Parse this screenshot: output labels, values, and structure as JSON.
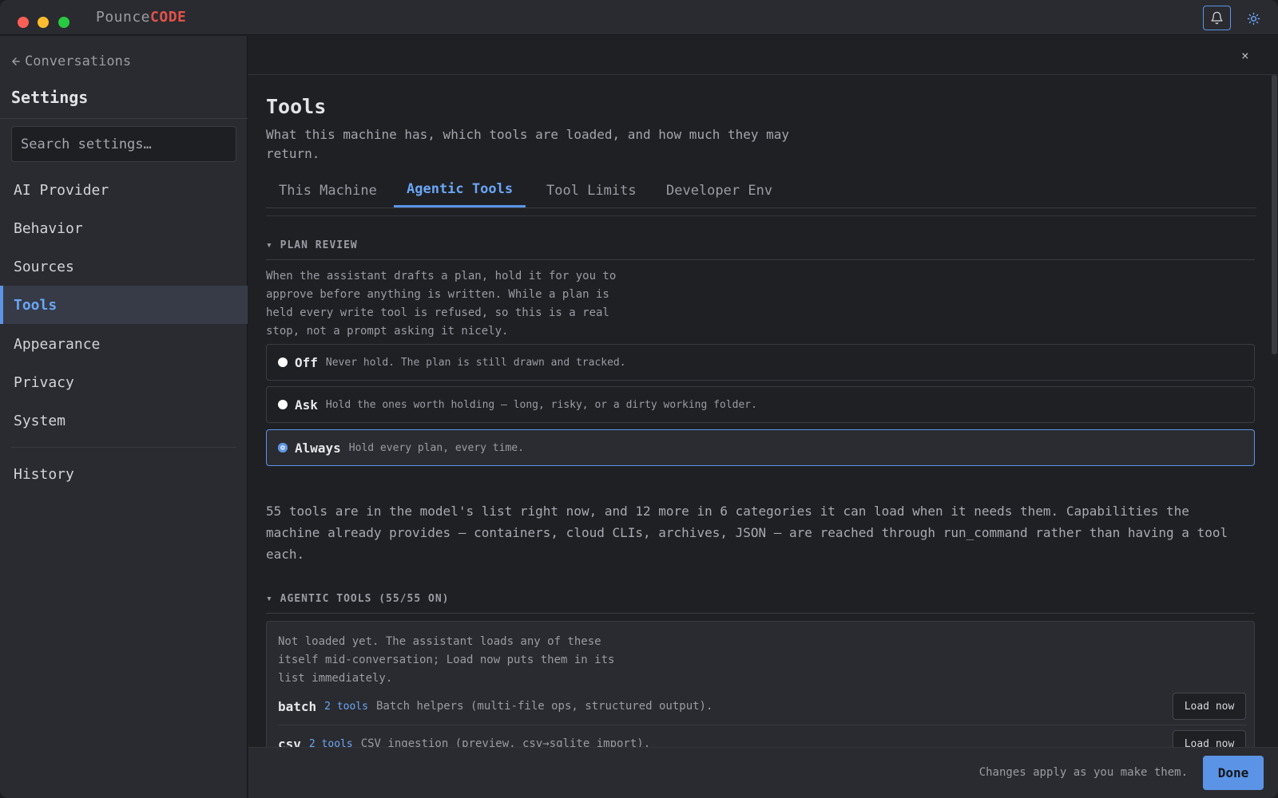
{
  "app": {
    "brand_a": "Pounce",
    "brand_b": "CODE"
  },
  "titlebar": {
    "bell_icon": "bell-icon",
    "theme_icon": "sun-icon"
  },
  "sidebar": {
    "back_label": "Conversations",
    "title": "Settings",
    "search_placeholder": "Search settings…",
    "items": [
      {
        "label": "AI Provider"
      },
      {
        "label": "Behavior"
      },
      {
        "label": "Sources"
      },
      {
        "label": "Tools",
        "active": true
      },
      {
        "label": "Appearance"
      },
      {
        "label": "Privacy"
      },
      {
        "label": "System"
      }
    ],
    "history_label": "History"
  },
  "main": {
    "close_label": "×",
    "title": "Tools",
    "subtitle": "What this machine has, which tools are loaded, and how much they may return.",
    "tabs": [
      {
        "label": "This Machine"
      },
      {
        "label": "Agentic Tools",
        "active": true
      },
      {
        "label": "Tool Limits"
      },
      {
        "label": "Developer Env"
      }
    ],
    "plan_review": {
      "heading": "▾ PLAN REVIEW",
      "description": "When the assistant drafts a plan, hold it for you to approve before anything is written. While a plan is held every write tool is refused, so this is a real stop, not a prompt asking it nicely.",
      "options": [
        {
          "name": "Off",
          "desc": "Never hold. The plan is still drawn and tracked."
        },
        {
          "name": "Ask",
          "desc": "Hold the ones worth holding — long, risky, or a dirty working folder."
        },
        {
          "name": "Always",
          "desc": "Hold every plan, every time.",
          "selected": true
        }
      ]
    },
    "summary": "55 tools are in the model's list right now, and 12 more in 6 categories it can load when it needs them. Capabilities the machine already provides — containers, cloud CLIs, archives, JSON — are reached through run_command rather than having a tool each.",
    "agentic": {
      "heading": "▾ AGENTIC TOOLS (55/55 ON)",
      "not_loaded_desc": "Not loaded yet. The assistant loads any of these itself mid-conversation; Load now puts them in its list immediately.",
      "categories": [
        {
          "name": "batch",
          "count": "2 tools",
          "desc": "Batch helpers (multi-file ops, structured output).",
          "button": "Load now"
        },
        {
          "name": "csv",
          "count": "2 tools",
          "desc": "CSV ingestion (preview, csv→sqlite import).",
          "button": "Load now"
        }
      ]
    }
  },
  "footer": {
    "note": "Changes apply as you make them.",
    "done_label": "Done"
  },
  "colors": {
    "accent": "#5b94e6",
    "brand_red": "#e0524a",
    "background": "#1f2024",
    "panel": "#2a2b30"
  }
}
